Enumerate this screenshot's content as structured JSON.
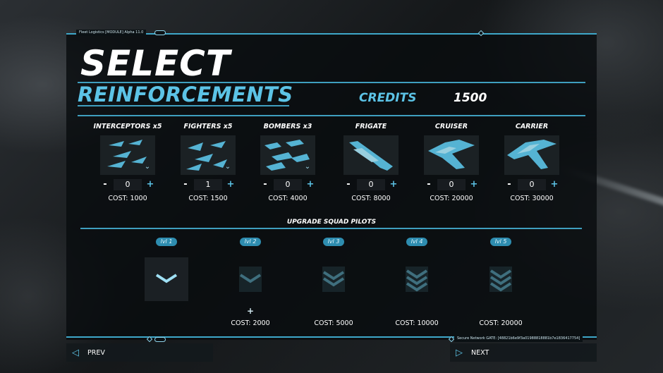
{
  "system": {
    "header_text": "Fleet Logistics [MODULE] Alpha 11.0",
    "footer_text": "Secure Network GATE: [48821b6e9f3a01988818881b7e1836417754]"
  },
  "title": {
    "line1": "SELECT",
    "line2": "REINFORCEMENTS"
  },
  "credits": {
    "label": "CREDITS",
    "value": "1500"
  },
  "ships": [
    {
      "name": "INTERCEPTORS x5",
      "quantity": "0",
      "cost": "COST: 1000",
      "icon": "interceptor-squad-icon",
      "expandable": true
    },
    {
      "name": "FIGHTERS x5",
      "quantity": "1",
      "cost": "COST: 1500",
      "icon": "fighter-squad-icon",
      "expandable": true
    },
    {
      "name": "BOMBERS x3",
      "quantity": "0",
      "cost": "COST: 4000",
      "icon": "bomber-squad-icon",
      "expandable": true
    },
    {
      "name": "FRIGATE",
      "quantity": "0",
      "cost": "COST: 8000",
      "icon": "frigate-icon",
      "expandable": false
    },
    {
      "name": "CRUISER",
      "quantity": "0",
      "cost": "COST: 20000",
      "icon": "cruiser-icon",
      "expandable": false
    },
    {
      "name": "CARRIER",
      "quantity": "0",
      "cost": "COST: 30000",
      "icon": "carrier-icon",
      "expandable": false
    }
  ],
  "stepper": {
    "minus": "-",
    "plus": "+"
  },
  "upgrade": {
    "title": "UPGRADE SQUAD PILOTS",
    "plus": "+",
    "levels": [
      {
        "label": "lvl 1",
        "cost": "",
        "active": true,
        "chevrons": 1
      },
      {
        "label": "lvl 2",
        "cost": "COST: 2000",
        "active": false,
        "chevrons": 1
      },
      {
        "label": "lvl 3",
        "cost": "COST: 5000",
        "active": false,
        "chevrons": 2
      },
      {
        "label": "lvl 4",
        "cost": "COST: 10000",
        "active": false,
        "chevrons": 3
      },
      {
        "label": "lvl 5",
        "cost": "COST: 20000",
        "active": false,
        "chevrons": 3
      }
    ]
  },
  "nav": {
    "prev": "PREV",
    "next": "NEXT"
  },
  "colors": {
    "accent": "#5cc3e6",
    "line": "#3f9fbf",
    "badge": "#2e8db0"
  }
}
